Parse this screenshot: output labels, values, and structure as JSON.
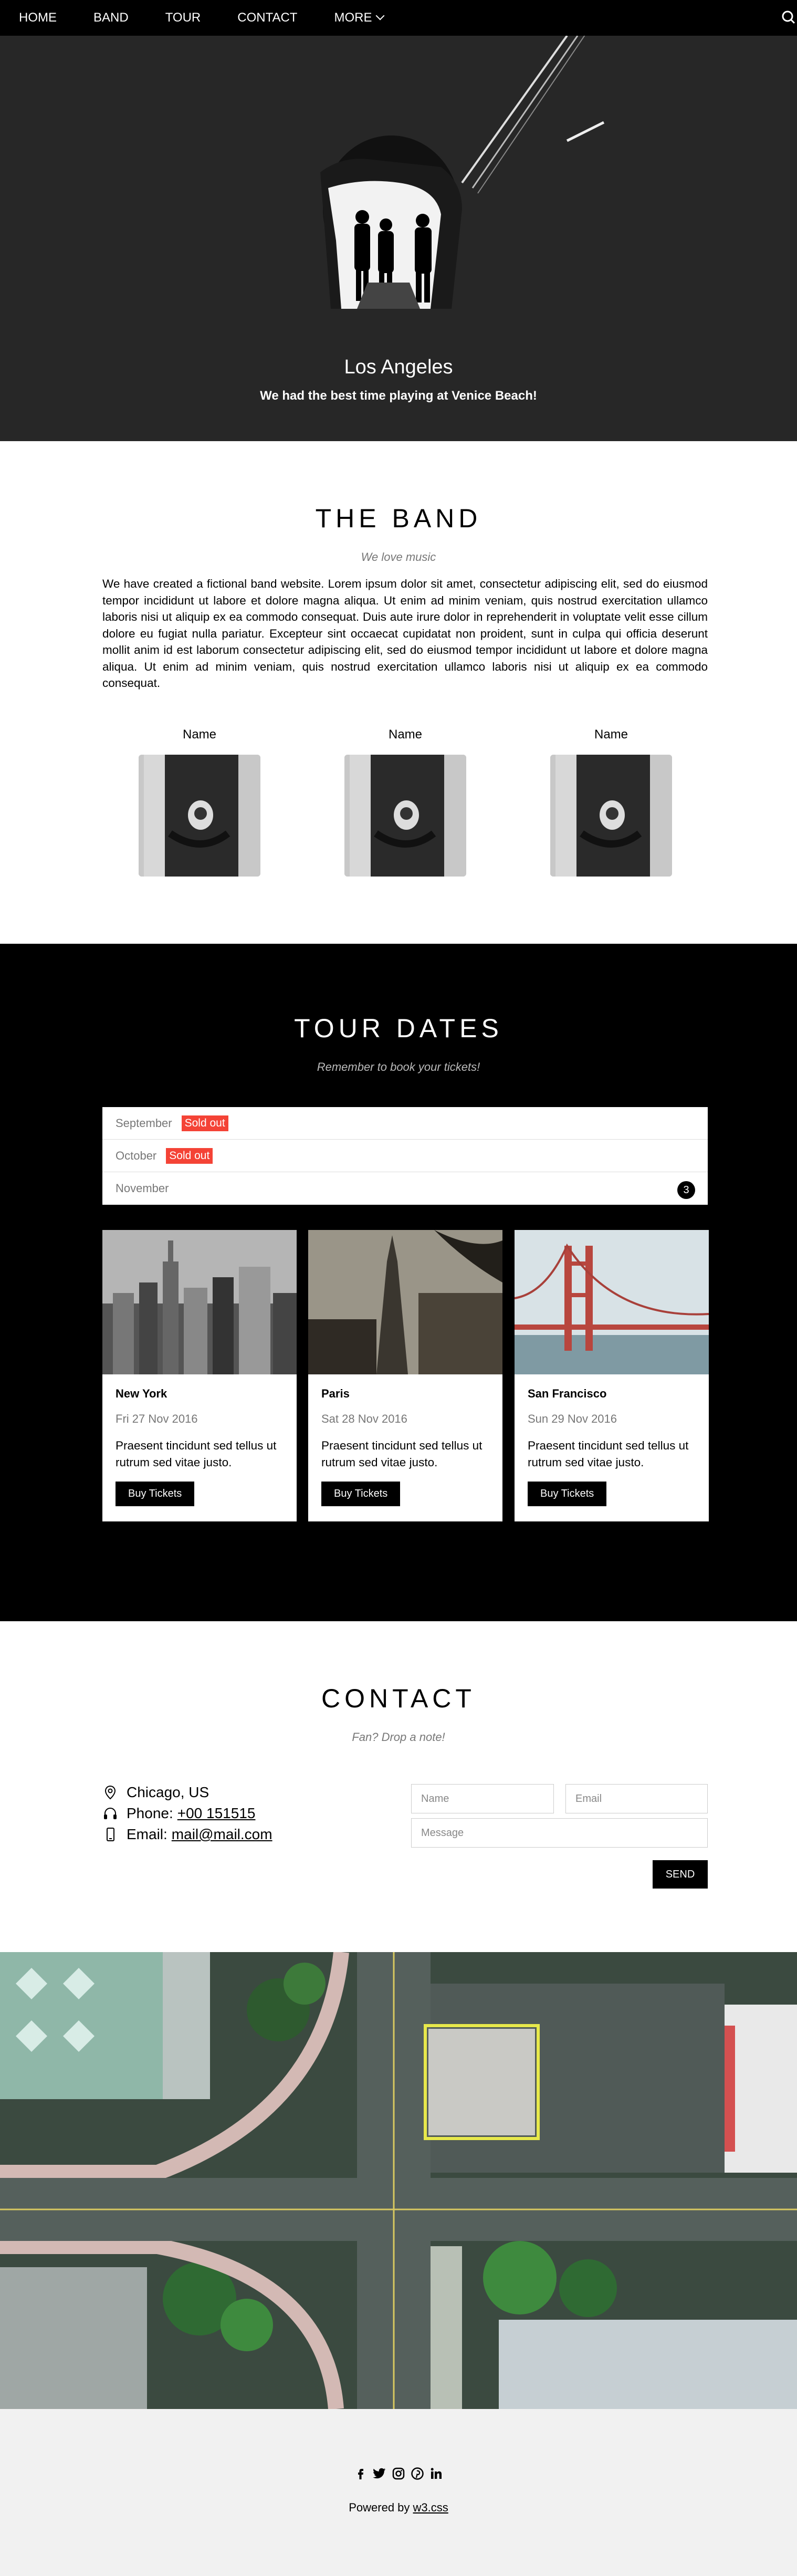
{
  "nav": {
    "items": [
      "HOME",
      "BAND",
      "TOUR",
      "CONTACT",
      "MORE"
    ],
    "search_icon": "search-icon"
  },
  "hero": {
    "title": "Los Angeles",
    "subtitle": "We had the best time playing at Venice Beach!"
  },
  "band": {
    "title": "THE BAND",
    "subtitle": "We love music",
    "text": "We have created a fictional band website. Lorem ipsum dolor sit amet, consectetur adipiscing elit, sed do eiusmod tempor incididunt ut labore et dolore magna aliqua. Ut enim ad minim veniam, quis nostrud exercitation ullamco laboris nisi ut aliquip ex ea commodo consequat. Duis aute irure dolor in reprehenderit in voluptate velit esse cillum dolore eu fugiat nulla pariatur. Excepteur sint occaecat cupidatat non proident, sunt in culpa qui officia deserunt mollit anim id est laborum consectetur adipiscing elit, sed do eiusmod tempor incididunt ut labore et dolore magna aliqua. Ut enim ad minim veniam, quis nostrud exercitation ullamco laboris nisi ut aliquip ex ea commodo consequat.",
    "members": [
      {
        "name": "Name"
      },
      {
        "name": "Name"
      },
      {
        "name": "Name"
      }
    ]
  },
  "tour": {
    "title": "TOUR DATES",
    "subtitle": "Remember to book your tickets!",
    "months": [
      {
        "label": "September",
        "badge": "Sold out"
      },
      {
        "label": "October",
        "badge": "Sold out"
      },
      {
        "label": "November",
        "count": "3"
      }
    ],
    "cards": [
      {
        "city": "New York",
        "date": "Fri 27 Nov 2016",
        "text": "Praesent tincidunt sed tellus ut rutrum sed vitae justo.",
        "button": "Buy Tickets"
      },
      {
        "city": "Paris",
        "date": "Sat 28 Nov 2016",
        "text": "Praesent tincidunt sed tellus ut rutrum sed vitae justo.",
        "button": "Buy Tickets"
      },
      {
        "city": "San Francisco",
        "date": "Sun 29 Nov 2016",
        "text": "Praesent tincidunt sed tellus ut rutrum sed vitae justo.",
        "button": "Buy Tickets"
      }
    ]
  },
  "contact": {
    "title": "CONTACT",
    "subtitle": "Fan? Drop a note!",
    "location": "Chicago, US",
    "phone_label": "Phone:",
    "phone": "+00 151515",
    "email_label": "Email:",
    "email": "mail@mail.com",
    "name_placeholder": "Name",
    "email_placeholder": "Email",
    "message_placeholder": "Message",
    "send": "SEND"
  },
  "footer": {
    "powered_prefix": "Powered by",
    "powered_link": "w3.css",
    "social": [
      "facebook-icon",
      "twitter-icon",
      "instagram-icon",
      "pinterest-icon",
      "linkedin-icon"
    ]
  },
  "colors": {
    "sold_out": "#f44336",
    "dark": "#000000",
    "hero_bg": "#272727"
  }
}
